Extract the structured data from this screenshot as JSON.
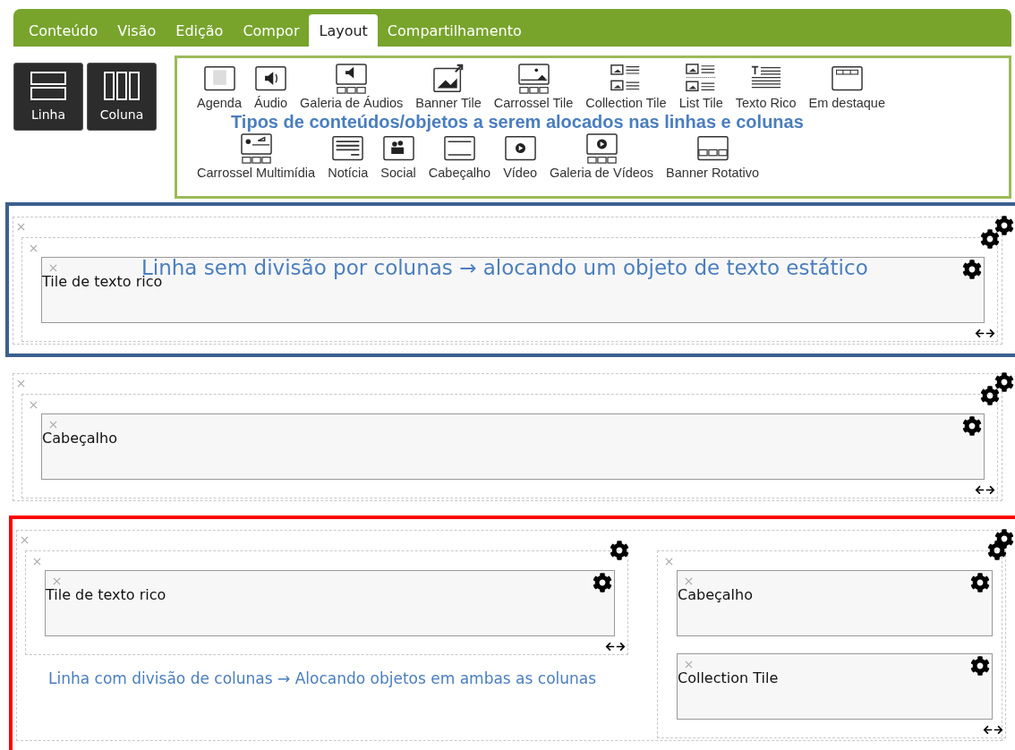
{
  "tabs": [
    {
      "label": "Conteúdo",
      "selected": false
    },
    {
      "label": "Visão",
      "selected": false
    },
    {
      "label": "Edição",
      "selected": false
    },
    {
      "label": "Compor",
      "selected": false
    },
    {
      "label": "Layout",
      "selected": true
    },
    {
      "label": "Compartilhamento",
      "selected": false
    }
  ],
  "structure_buttons": [
    {
      "label": "Linha",
      "kind": "row"
    },
    {
      "label": "Coluna",
      "kind": "column"
    }
  ],
  "content_types": {
    "top_items": [
      {
        "label": "Agenda",
        "kind": "agenda"
      },
      {
        "label": "Áudio",
        "kind": "audio"
      },
      {
        "label": "Galeria de Áudios",
        "kind": "audio-gallery"
      },
      {
        "label": "Banner Tile",
        "kind": "banner"
      },
      {
        "label": "Carrossel Tile",
        "kind": "carousel"
      },
      {
        "label": "Collection Tile",
        "kind": "collection"
      },
      {
        "label": "List Tile",
        "kind": "list"
      },
      {
        "label": "Texto Rico",
        "kind": "rich-text"
      },
      {
        "label": "Em destaque",
        "kind": "featured"
      }
    ],
    "annotation": "Tipos de conteúdos/objetos a serem alocados nas linhas e colunas",
    "bottom_items": [
      {
        "label": "Carrossel Multimídia",
        "kind": "media-carousel"
      },
      {
        "label": "Notícia",
        "kind": "news"
      },
      {
        "label": "Social",
        "kind": "social"
      },
      {
        "label": "Cabeçalho",
        "kind": "header"
      },
      {
        "label": "Vídeo",
        "kind": "video"
      },
      {
        "label": "Galeria de Vídeos",
        "kind": "video-gallery"
      },
      {
        "label": "Banner Rotativo",
        "kind": "rotating-banner"
      }
    ]
  },
  "sections": [
    {
      "color": "#3b5f8e",
      "annotation": "Linha sem divisão por colunas → alocando um objeto de texto estático",
      "columns": [
        {
          "tiles": [
            "Tile de texto rico"
          ]
        }
      ]
    },
    {
      "columns": [
        {
          "tiles": [
            "Cabeçalho"
          ]
        }
      ]
    },
    {
      "color": "#ff0000",
      "annotation": "Linha com divisão de colunas → Alocando objetos em ambas as colunas",
      "columns": [
        {
          "tiles": [
            "Tile de texto rico"
          ]
        },
        {
          "tiles": [
            "Cabeçalho",
            "Collection Tile"
          ]
        }
      ]
    }
  ]
}
